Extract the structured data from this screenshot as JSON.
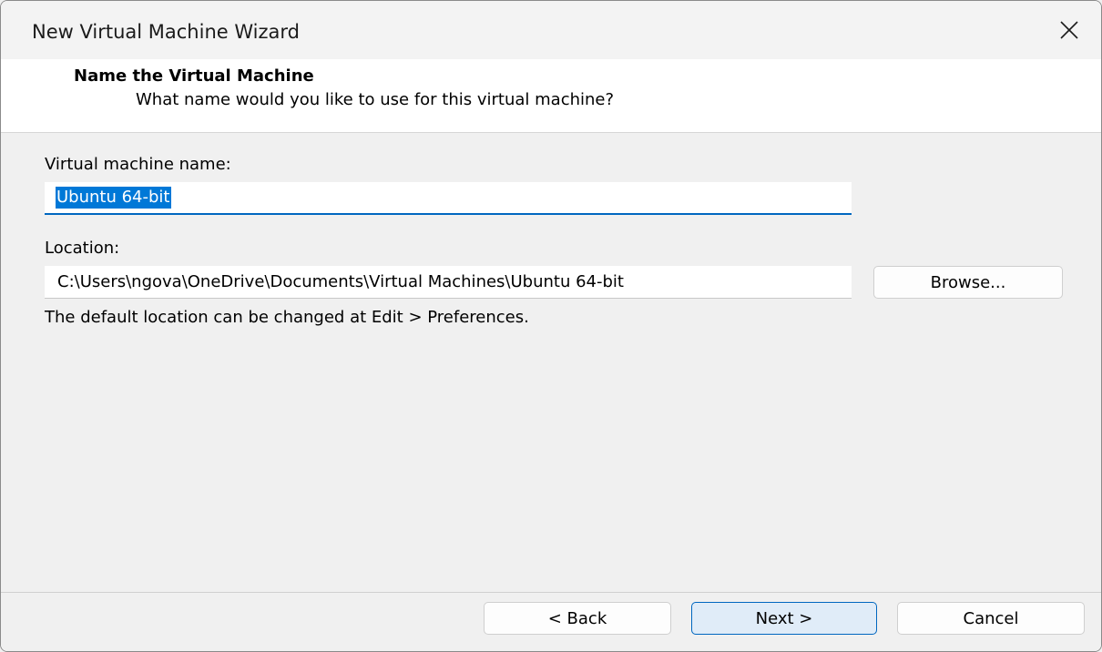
{
  "window": {
    "title": "New Virtual Machine Wizard"
  },
  "header": {
    "title": "Name the Virtual Machine",
    "subtitle": "What name would you like to use for this virtual machine?"
  },
  "form": {
    "name_label": "Virtual machine name:",
    "name_value": "Ubuntu 64-bit",
    "location_label": "Location:",
    "location_value": "C:\\Users\\ngova\\OneDrive\\Documents\\Virtual Machines\\Ubuntu 64-bit",
    "browse_label": "Browse...",
    "hint": "The default location can be changed at Edit > Preferences."
  },
  "footer": {
    "back_label": "< Back",
    "next_label": "Next >",
    "cancel_label": "Cancel"
  },
  "colors": {
    "accent": "#0067c0",
    "selection": "#0078d7"
  }
}
